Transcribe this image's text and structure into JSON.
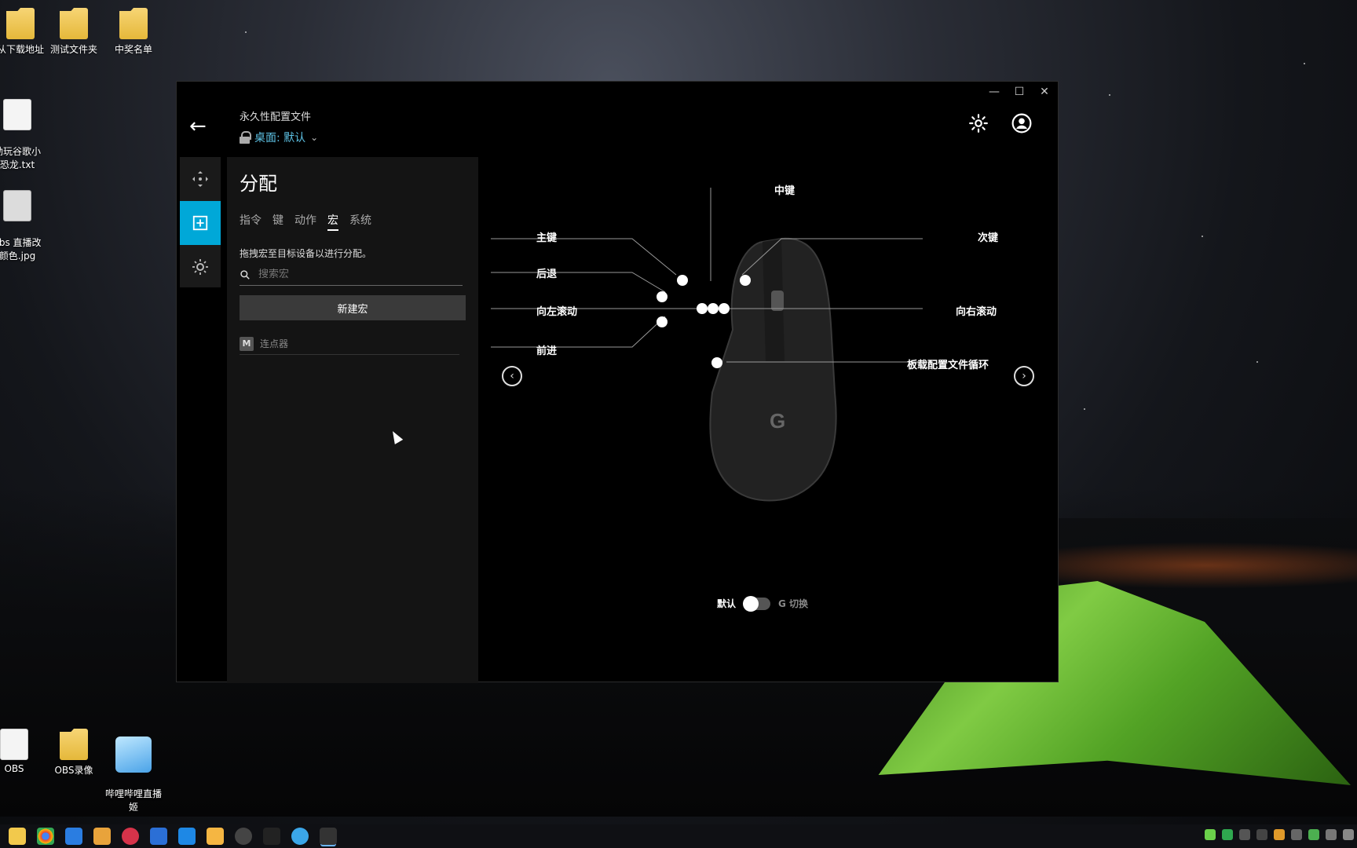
{
  "desktop": {
    "icons": [
      {
        "label": "从下载地址",
        "kind": "folder"
      },
      {
        "label": "测试文件夹",
        "kind": "folder"
      },
      {
        "label": "中奖名单",
        "kind": "folder"
      },
      {
        "label": "劲玩谷歌小\n恐龙.txt",
        "kind": "file"
      },
      {
        "label": "obs 直播改\n颜色.jpg",
        "kind": "img"
      },
      {
        "label": "OBS",
        "kind": "file"
      },
      {
        "label": "OBS录像",
        "kind": "folder"
      },
      {
        "label": "哔哩哔哩直播\n姬",
        "kind": "app"
      }
    ]
  },
  "window": {
    "controls": {
      "minimize": "—",
      "maximize": "☐",
      "close": "✕"
    },
    "back": "←",
    "profile_title": "永久性配置文件",
    "profile_value": "桌面: 默认",
    "profile_chevron": "⌄"
  },
  "panel": {
    "title": "分配",
    "tabs": [
      "指令",
      "键",
      "动作",
      "宏",
      "系统"
    ],
    "active_tab": "宏",
    "hint": "拖拽宏至目标设备以进行分配。",
    "search_placeholder": "搜索宏",
    "new_button": "新建宏",
    "macros": [
      {
        "badge": "M",
        "name": "连点器"
      }
    ]
  },
  "mouse": {
    "labels": {
      "middle": "中键",
      "primary": "主键",
      "secondary": "次键",
      "back": "后退",
      "scroll_left": "向左滚动",
      "scroll_right": "向右滚动",
      "forward": "前进",
      "profile_cycle": "板载配置文件循环"
    },
    "prev": "‹",
    "next": "›"
  },
  "mode_toggle": {
    "left": "默认",
    "right": "G 切换"
  },
  "colors": {
    "accent": "#00a8d8",
    "profile": "#5ec3e6"
  }
}
